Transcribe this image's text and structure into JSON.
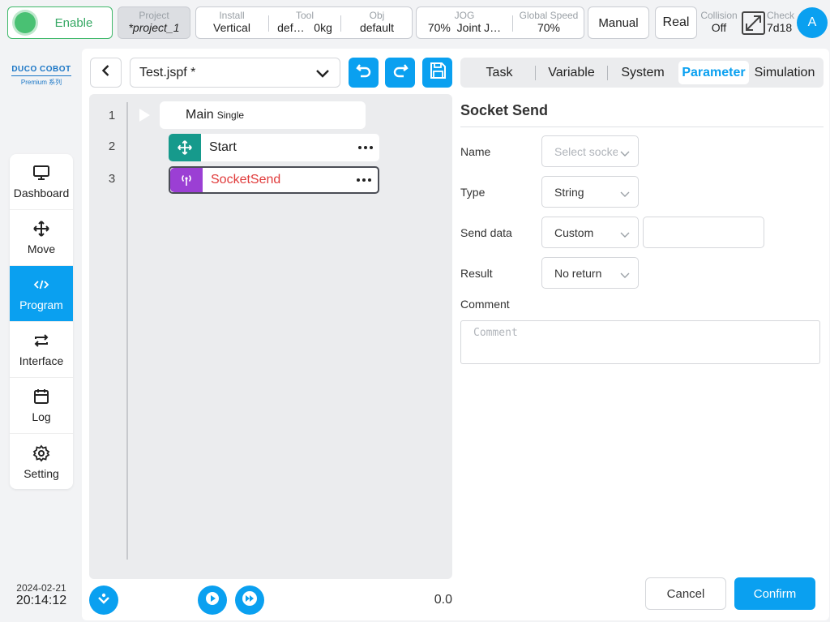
{
  "topbar": {
    "enable_label": "Enable",
    "project": {
      "key": "Project",
      "value": "*project_1"
    },
    "install": {
      "key": "Install",
      "value": "Vertical"
    },
    "tool": {
      "key": "Tool",
      "value_name": "def…",
      "value_weight": "0kg"
    },
    "obj": {
      "key": "Obj",
      "value": "default"
    },
    "jog": {
      "key": "JOG",
      "value_speed": "70%",
      "value_mode": "Joint J…"
    },
    "global_speed": {
      "key": "Global Speed",
      "value": "70%"
    },
    "mode_label": "Manual",
    "real_label": "Real",
    "collision": {
      "key": "Collision",
      "value": "Off"
    },
    "check": {
      "key": "Check",
      "value": "7d18"
    },
    "avatar_label": "A"
  },
  "logo": {
    "line1": "DUCO COBOT",
    "line2": "Premium 系列"
  },
  "sidebar": {
    "items": [
      {
        "label": "Dashboard",
        "icon": "monitor-icon"
      },
      {
        "label": "Move",
        "icon": "move-icon"
      },
      {
        "label": "Program",
        "icon": "code-icon",
        "active": true
      },
      {
        "label": "Interface",
        "icon": "swap-icon"
      },
      {
        "label": "Log",
        "icon": "calendar-icon"
      },
      {
        "label": "Setting",
        "icon": "gear-icon"
      }
    ]
  },
  "datetime": {
    "date": "2024-02-21",
    "time": "20:14:12"
  },
  "editor": {
    "file_name": "Test.jspf *",
    "lines": [
      {
        "no": "1",
        "label": "Main",
        "sub": "Single"
      },
      {
        "no": "2",
        "label": "Start",
        "icon": "move-icon",
        "color": "#169a8c"
      },
      {
        "no": "3",
        "label": "SocketSend",
        "icon": "antenna-icon",
        "color": "#9b3fd4",
        "label_color": "#e03a3a"
      }
    ],
    "progress_value": "0.0"
  },
  "tabs": [
    "Task",
    "Variable",
    "System",
    "Parameter",
    "Simulation"
  ],
  "active_tab": "Parameter",
  "form": {
    "title": "Socket Send",
    "name": {
      "label": "Name",
      "placeholder": "Select socket"
    },
    "type": {
      "label": "Type",
      "value": "String"
    },
    "send_data": {
      "label": "Send data",
      "value": "Custom",
      "custom_value": ""
    },
    "result": {
      "label": "Result",
      "value": "No return"
    },
    "comment": {
      "label": "Comment",
      "placeholder": "Comment"
    },
    "cancel_label": "Cancel",
    "confirm_label": "Confirm"
  },
  "colors": {
    "accent": "#0aa0f0",
    "enable": "#49c173",
    "start_node": "#169a8c",
    "socket_node": "#9b3fd4",
    "error_text": "#e03a3a"
  }
}
